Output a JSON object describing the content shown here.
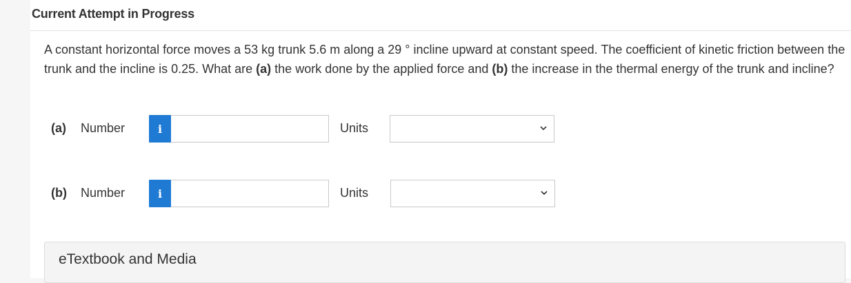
{
  "header": {
    "title": "Current Attempt in Progress"
  },
  "question": {
    "intro": "A constant horizontal force moves a 53 kg trunk 5.6 m along a 29 ° incline upward at constant speed. The coefficient of kinetic friction between the trunk and the incline is 0.25. What are ",
    "part_a_marker": "(a)",
    "mid_text": " the work done by the applied force and ",
    "part_b_marker": "(b)",
    "end_text": " the increase in the thermal energy of the trunk and incline?"
  },
  "answers": [
    {
      "part": "(a)",
      "number_label": "Number",
      "info_icon": "i",
      "number_value": "",
      "units_label": "Units",
      "units_selected": ""
    },
    {
      "part": "(b)",
      "number_label": "Number",
      "info_icon": "i",
      "number_value": "",
      "units_label": "Units",
      "units_selected": ""
    }
  ],
  "etextbook": {
    "label": "eTextbook and Media"
  },
  "colors": {
    "info_button": "#1f7ad4",
    "background": "#f6f6f6",
    "panel": "#ffffff"
  }
}
